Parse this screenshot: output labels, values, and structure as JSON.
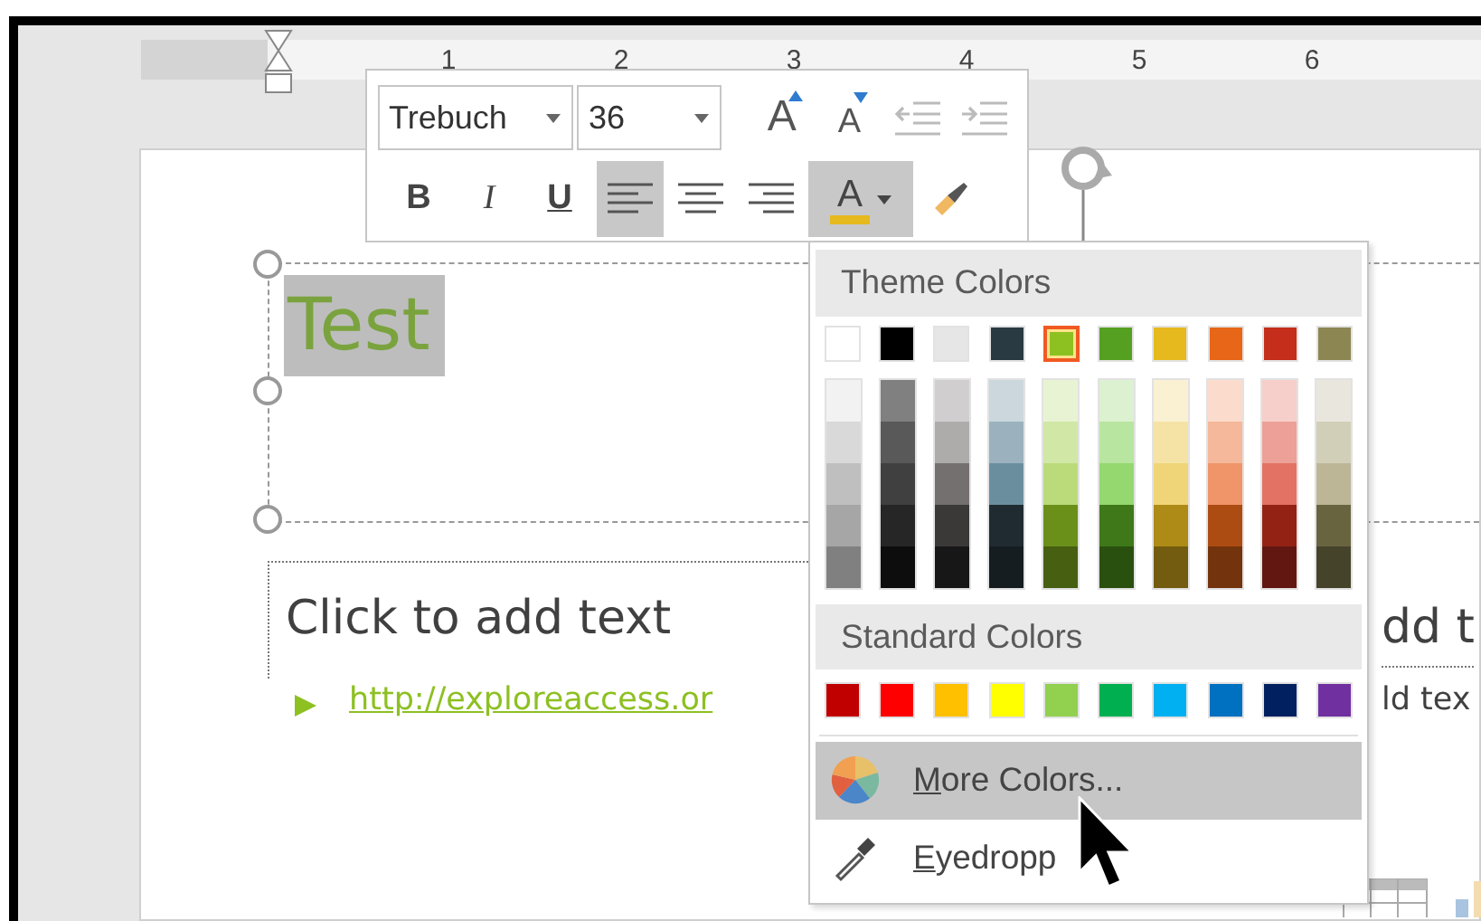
{
  "ruler": {
    "labels": [
      "1",
      "2",
      "3",
      "4",
      "5",
      "6"
    ]
  },
  "mini_toolbar": {
    "font": {
      "value": "Trebuch"
    },
    "size": {
      "value": "36"
    },
    "row_1": [
      {
        "kind": "grow",
        "label": "A",
        "disabled": false
      },
      {
        "kind": "shrink",
        "label": "A",
        "disabled": false
      },
      {
        "kind": "outdent",
        "disabled": true
      },
      {
        "kind": "indent",
        "disabled": true
      }
    ],
    "row_2": [
      {
        "kind": "bold",
        "label": "B",
        "selected": false
      },
      {
        "kind": "italic",
        "label": "I",
        "selected": false
      },
      {
        "kind": "underline",
        "label": "U",
        "selected": false
      },
      {
        "kind": "align_left",
        "selected": true
      },
      {
        "kind": "align_center",
        "selected": false
      },
      {
        "kind": "align_right",
        "selected": false
      },
      {
        "kind": "font_color",
        "label": "A",
        "selected": true
      },
      {
        "kind": "painter",
        "selected": false
      }
    ]
  },
  "slide": {
    "title": "Test",
    "body_placeholder": "Click to add text",
    "link": "http://exploreaccess.or",
    "right_placeholder": "dd t",
    "right_text": "ld tex"
  },
  "color_menu": {
    "theme_header": "Theme Colors",
    "theme_colors": [
      {
        "color": "#ffffff",
        "selected": false,
        "shades": [
          {
            "color": "#f2f2f2"
          },
          {
            "color": "#d9d9d9"
          },
          {
            "color": "#bfbfbf"
          },
          {
            "color": "#a6a6a6"
          },
          {
            "color": "#808080"
          }
        ]
      },
      {
        "color": "#000000",
        "selected": false,
        "shades": [
          {
            "color": "#808080"
          },
          {
            "color": "#595959"
          },
          {
            "color": "#404040"
          },
          {
            "color": "#262626"
          },
          {
            "color": "#0d0d0d"
          }
        ]
      },
      {
        "color": "#e7e6e6",
        "selected": false,
        "shades": [
          {
            "color": "#d0cece"
          },
          {
            "color": "#aeabab"
          },
          {
            "color": "#757070"
          },
          {
            "color": "#3b3838"
          },
          {
            "color": "#181717"
          }
        ]
      },
      {
        "color": "#2a3a42",
        "selected": false,
        "shades": [
          {
            "color": "#ccd7dd"
          },
          {
            "color": "#9bb2be"
          },
          {
            "color": "#6a8e9e"
          },
          {
            "color": "#1f2b31"
          },
          {
            "color": "#151d21"
          }
        ]
      },
      {
        "color": "#8dc021",
        "selected": true,
        "shades": [
          {
            "color": "#e8f3d3"
          },
          {
            "color": "#d1e7a6"
          },
          {
            "color": "#bbdb7a"
          },
          {
            "color": "#6a901a"
          },
          {
            "color": "#465f11"
          }
        ]
      },
      {
        "color": "#55a021",
        "selected": false,
        "shades": [
          {
            "color": "#dbf1cf"
          },
          {
            "color": "#b8e59f"
          },
          {
            "color": "#94d86f"
          },
          {
            "color": "#3f7819"
          },
          {
            "color": "#2a5010"
          }
        ]
      },
      {
        "color": "#e6b91e",
        "selected": false,
        "shades": [
          {
            "color": "#faf1d2"
          },
          {
            "color": "#f5e3a5"
          },
          {
            "color": "#f0d578"
          },
          {
            "color": "#ad8b16"
          },
          {
            "color": "#735c0f"
          }
        ]
      },
      {
        "color": "#e76618",
        "selected": false,
        "shades": [
          {
            "color": "#fadbcc"
          },
          {
            "color": "#f5b89a"
          },
          {
            "color": "#f0946a"
          },
          {
            "color": "#ad4c12"
          },
          {
            "color": "#73330c"
          }
        ]
      },
      {
        "color": "#c42e1a",
        "selected": false,
        "shades": [
          {
            "color": "#f6cfca"
          },
          {
            "color": "#eda097"
          },
          {
            "color": "#e47264"
          },
          {
            "color": "#932214"
          },
          {
            "color": "#621710"
          }
        ]
      },
      {
        "color": "#8c8653",
        "selected": false,
        "shades": [
          {
            "color": "#e9e7dd"
          },
          {
            "color": "#d2cfb9"
          },
          {
            "color": "#bcb697"
          },
          {
            "color": "#696440"
          },
          {
            "color": "#46432b"
          }
        ]
      }
    ],
    "standard_header": "Standard Colors",
    "standard_colors": [
      {
        "color": "#c00000"
      },
      {
        "color": "#ff0000"
      },
      {
        "color": "#ffc000"
      },
      {
        "color": "#ffff00"
      },
      {
        "color": "#92d050"
      },
      {
        "color": "#00b050"
      },
      {
        "color": "#00b0f0"
      },
      {
        "color": "#0070c0"
      },
      {
        "color": "#002060"
      },
      {
        "color": "#7030a0"
      }
    ],
    "items": [
      {
        "kind": "more_colors",
        "label": "More Colors...",
        "selected": true
      },
      {
        "kind": "eyedropper",
        "label": "Eyedropp",
        "selected": false
      }
    ]
  }
}
